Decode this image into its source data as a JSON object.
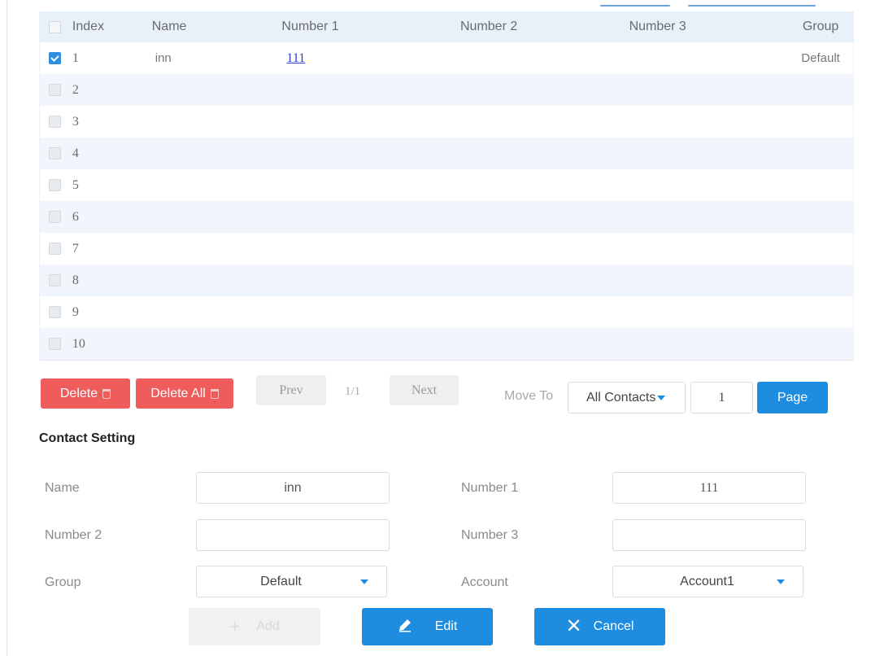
{
  "table": {
    "headers": {
      "index": "Index",
      "name": "Name",
      "number1": "Number 1",
      "number2": "Number 2",
      "number3": "Number 3",
      "group": "Group"
    },
    "rows": [
      {
        "index": "1",
        "name": "inn",
        "number1": "111",
        "number2": "",
        "number3": "",
        "group": "Default",
        "checked": true
      },
      {
        "index": "2",
        "name": "",
        "number1": "",
        "number2": "",
        "number3": "",
        "group": "",
        "checked": false
      },
      {
        "index": "3",
        "name": "",
        "number1": "",
        "number2": "",
        "number3": "",
        "group": "",
        "checked": false
      },
      {
        "index": "4",
        "name": "",
        "number1": "",
        "number2": "",
        "number3": "",
        "group": "",
        "checked": false
      },
      {
        "index": "5",
        "name": "",
        "number1": "",
        "number2": "",
        "number3": "",
        "group": "",
        "checked": false
      },
      {
        "index": "6",
        "name": "",
        "number1": "",
        "number2": "",
        "number3": "",
        "group": "",
        "checked": false
      },
      {
        "index": "7",
        "name": "",
        "number1": "",
        "number2": "",
        "number3": "",
        "group": "",
        "checked": false
      },
      {
        "index": "8",
        "name": "",
        "number1": "",
        "number2": "",
        "number3": "",
        "group": "",
        "checked": false
      },
      {
        "index": "9",
        "name": "",
        "number1": "",
        "number2": "",
        "number3": "",
        "group": "",
        "checked": false
      },
      {
        "index": "10",
        "name": "",
        "number1": "",
        "number2": "",
        "number3": "",
        "group": "",
        "checked": false
      }
    ]
  },
  "toolbar": {
    "delete_label": "Delete",
    "delete_all_label": "Delete All",
    "prev_label": "Prev",
    "page_info": "1/1",
    "next_label": "Next",
    "move_to_label": "Move To",
    "move_to_selected": "All Contacts",
    "page_value": "1",
    "page_button_label": "Page"
  },
  "contact_setting": {
    "title": "Contact Setting",
    "name_label": "Name",
    "name_value": "inn",
    "number1_label": "Number 1",
    "number1_value": "111",
    "number2_label": "Number 2",
    "number2_value": "",
    "number3_label": "Number 3",
    "number3_value": "",
    "group_label": "Group",
    "group_value": "Default",
    "account_label": "Account",
    "account_value": "Account1"
  },
  "actions": {
    "add_label": "Add",
    "edit_label": "Edit",
    "cancel_label": "Cancel"
  },
  "colors": {
    "accent_blue": "#1e8de0",
    "danger_red": "#ef5c5c",
    "header_bg": "#e8f0fa",
    "alt_row_bg": "#f1f6fc"
  },
  "icons": {
    "delete": "trash-icon",
    "dropdown": "caret-down-icon",
    "add": "plus-icon",
    "edit": "pencil-icon",
    "cancel": "close-icon"
  }
}
